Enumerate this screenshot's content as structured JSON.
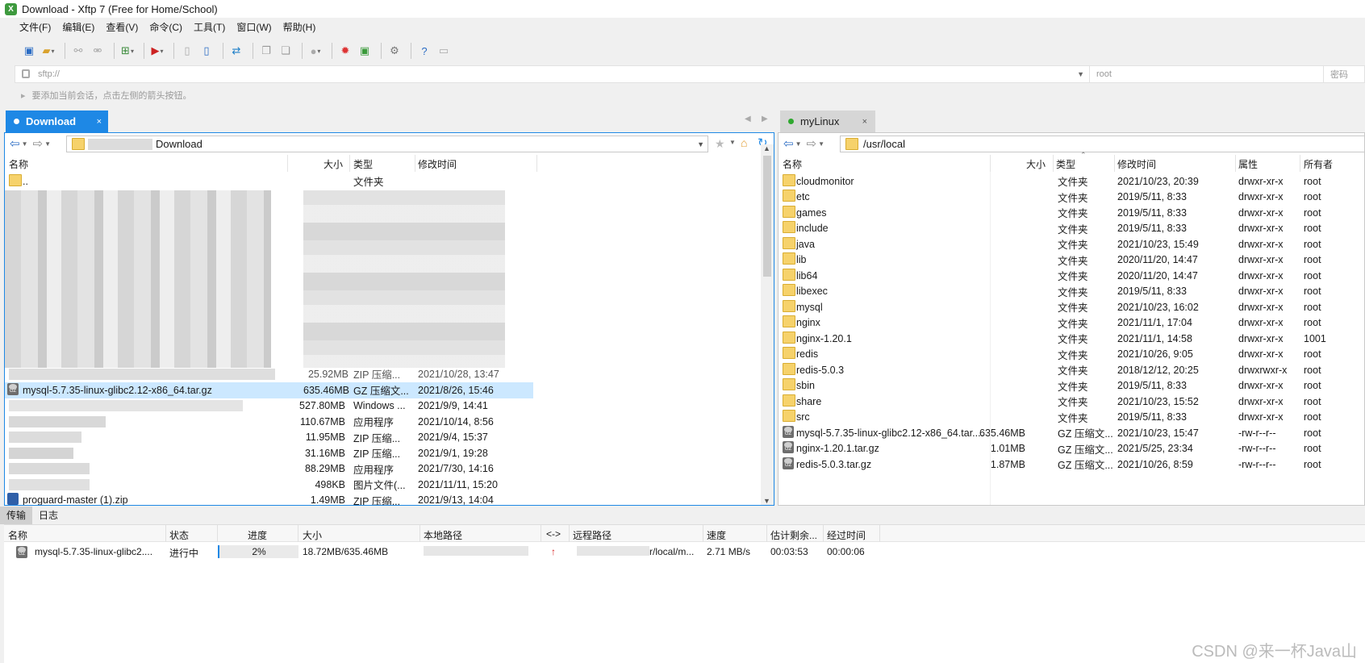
{
  "window": {
    "title": "Download - Xftp 7 (Free for Home/School)"
  },
  "menu": [
    "文件(F)",
    "编辑(E)",
    "查看(V)",
    "命令(C)",
    "工具(T)",
    "窗口(W)",
    "帮助(H)"
  ],
  "toolbar_icons": [
    "new-session-icon",
    "open-icon",
    "connect-icon",
    "disconnect-icon",
    "new-local-icon",
    "xshell-icon",
    "file-icon",
    "file-open-icon",
    "transfer-icon",
    "copy-icon",
    "paste-icon",
    "status-icon",
    "bug-icon",
    "xftp-icon",
    "settings-icon",
    "help-icon",
    "message-icon"
  ],
  "address": {
    "host": "sftp://",
    "user_placeholder": "root",
    "password_placeholder": "密码"
  },
  "hint": "要添加当前会话，点击左侧的箭头按钮。",
  "tabs": {
    "left": {
      "label": "Download",
      "close": "×"
    },
    "right": {
      "label": "myLinux",
      "close": "×"
    }
  },
  "local": {
    "path": "Download",
    "columns": [
      "名称",
      "大小",
      "类型",
      "修改时间"
    ],
    "parent_row": {
      "name": "..",
      "type": "文件夹"
    },
    "rows": [
      {
        "name": "",
        "size": "25.92MB",
        "type": "ZIP 压缩...",
        "modified": "2021/10/28, 13:47"
      },
      {
        "name": "mysql-5.7.35-linux-glibc2.12-x86_64.tar.gz",
        "size": "635.46MB",
        "type": "GZ 压缩文...",
        "modified": "2021/8/26, 15:46"
      },
      {
        "name": "",
        "size": "527.80MB",
        "type": "Windows ...",
        "modified": "2021/9/9, 14:41"
      },
      {
        "name": "",
        "size": "110.67MB",
        "type": "应用程序",
        "modified": "2021/10/14, 8:56"
      },
      {
        "name": "",
        "size": "11.95MB",
        "type": "ZIP 压缩...",
        "modified": "2021/9/4, 15:37"
      },
      {
        "name": "",
        "size": "31.16MB",
        "type": "ZIP 压缩...",
        "modified": "2021/9/1, 19:28"
      },
      {
        "name": "",
        "size": "88.29MB",
        "type": "应用程序",
        "modified": "2021/7/30, 14:16"
      },
      {
        "name": "",
        "size": "498KB",
        "type": "图片文件(...",
        "modified": "2021/11/11, 15:20"
      },
      {
        "name": "proguard-master (1).zip",
        "size": "1.49MB",
        "type": "ZIP 压缩...",
        "modified": "2021/9/13, 14:04"
      }
    ]
  },
  "remote": {
    "path": "/usr/local",
    "columns": [
      "名称",
      "大小",
      "类型",
      "修改时间",
      "属性",
      "所有者"
    ],
    "rows": [
      {
        "name": "cloudmonitor",
        "size": "",
        "type": "文件夹",
        "modified": "2021/10/23, 20:39",
        "perm": "drwxr-xr-x",
        "owner": "root",
        "kind": "folder"
      },
      {
        "name": "etc",
        "size": "",
        "type": "文件夹",
        "modified": "2019/5/11, 8:33",
        "perm": "drwxr-xr-x",
        "owner": "root",
        "kind": "folder"
      },
      {
        "name": "games",
        "size": "",
        "type": "文件夹",
        "modified": "2019/5/11, 8:33",
        "perm": "drwxr-xr-x",
        "owner": "root",
        "kind": "folder"
      },
      {
        "name": "include",
        "size": "",
        "type": "文件夹",
        "modified": "2019/5/11, 8:33",
        "perm": "drwxr-xr-x",
        "owner": "root",
        "kind": "folder"
      },
      {
        "name": "java",
        "size": "",
        "type": "文件夹",
        "modified": "2021/10/23, 15:49",
        "perm": "drwxr-xr-x",
        "owner": "root",
        "kind": "folder"
      },
      {
        "name": "lib",
        "size": "",
        "type": "文件夹",
        "modified": "2020/11/20, 14:47",
        "perm": "drwxr-xr-x",
        "owner": "root",
        "kind": "folder"
      },
      {
        "name": "lib64",
        "size": "",
        "type": "文件夹",
        "modified": "2020/11/20, 14:47",
        "perm": "drwxr-xr-x",
        "owner": "root",
        "kind": "folder"
      },
      {
        "name": "libexec",
        "size": "",
        "type": "文件夹",
        "modified": "2019/5/11, 8:33",
        "perm": "drwxr-xr-x",
        "owner": "root",
        "kind": "folder"
      },
      {
        "name": "mysql",
        "size": "",
        "type": "文件夹",
        "modified": "2021/10/23, 16:02",
        "perm": "drwxr-xr-x",
        "owner": "root",
        "kind": "folder"
      },
      {
        "name": "nginx",
        "size": "",
        "type": "文件夹",
        "modified": "2021/11/1, 17:04",
        "perm": "drwxr-xr-x",
        "owner": "root",
        "kind": "folder"
      },
      {
        "name": "nginx-1.20.1",
        "size": "",
        "type": "文件夹",
        "modified": "2021/11/1, 14:58",
        "perm": "drwxr-xr-x",
        "owner": "1001",
        "kind": "folder"
      },
      {
        "name": "redis",
        "size": "",
        "type": "文件夹",
        "modified": "2021/10/26, 9:05",
        "perm": "drwxr-xr-x",
        "owner": "root",
        "kind": "folder"
      },
      {
        "name": "redis-5.0.3",
        "size": "",
        "type": "文件夹",
        "modified": "2018/12/12, 20:25",
        "perm": "drwxrwxr-x",
        "owner": "root",
        "kind": "folder"
      },
      {
        "name": "sbin",
        "size": "",
        "type": "文件夹",
        "modified": "2019/5/11, 8:33",
        "perm": "drwxr-xr-x",
        "owner": "root",
        "kind": "folder"
      },
      {
        "name": "share",
        "size": "",
        "type": "文件夹",
        "modified": "2021/10/23, 15:52",
        "perm": "drwxr-xr-x",
        "owner": "root",
        "kind": "folder"
      },
      {
        "name": "src",
        "size": "",
        "type": "文件夹",
        "modified": "2019/5/11, 8:33",
        "perm": "drwxr-xr-x",
        "owner": "root",
        "kind": "folder"
      },
      {
        "name": "mysql-5.7.35-linux-glibc2.12-x86_64.tar....",
        "size": "635.46MB",
        "type": "GZ 压缩文...",
        "modified": "2021/10/23, 15:47",
        "perm": "-rw-r--r--",
        "owner": "root",
        "kind": "gz"
      },
      {
        "name": "nginx-1.20.1.tar.gz",
        "size": "1.01MB",
        "type": "GZ 压缩文...",
        "modified": "2021/5/25, 23:34",
        "perm": "-rw-r--r--",
        "owner": "root",
        "kind": "gz"
      },
      {
        "name": "redis-5.0.3.tar.gz",
        "size": "1.87MB",
        "type": "GZ 压缩文...",
        "modified": "2021/10/26, 8:59",
        "perm": "-rw-r--r--",
        "owner": "root",
        "kind": "gz"
      }
    ]
  },
  "bottom_tabs": [
    "传输",
    "日志"
  ],
  "transfer": {
    "columns": [
      "名称",
      "状态",
      "进度",
      "大小",
      "本地路径",
      "<->",
      "远程路径",
      "速度",
      "估计剩余...",
      "经过时间"
    ],
    "row": {
      "name": "mysql-5.7.35-linux-glibc2....",
      "status": "进行中",
      "progress": "2%",
      "progress_value": 0.02,
      "size": "18.72MB/635.46MB",
      "local": "",
      "direction": "↑",
      "remote": "r/local/m...",
      "speed": "2.71 MB/s",
      "remaining": "00:03:53",
      "elapsed": "00:00:06"
    }
  },
  "watermark": "CSDN @来一杯Java山"
}
